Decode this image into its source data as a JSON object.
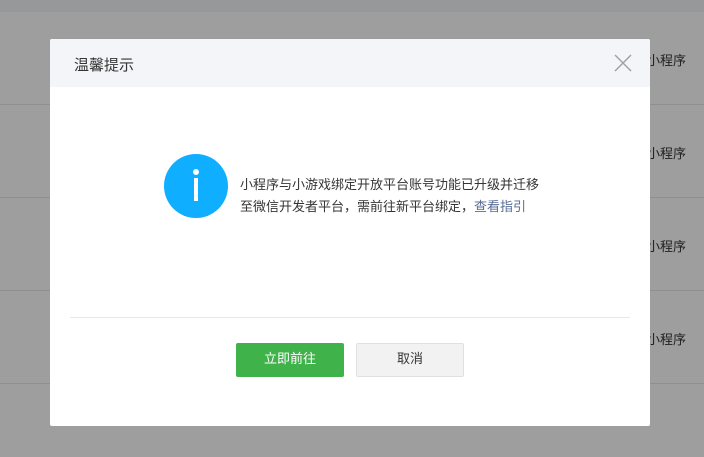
{
  "background": {
    "row_labels": [
      "小程序",
      "小程序",
      "小程序",
      "小程序"
    ]
  },
  "dialog": {
    "title": "温馨提示",
    "message_text": "小程序与小游戏绑定开放平台账号功能已升级并迁移至微信开发者平台，需前往新平台绑定，",
    "link_text": "查看指引",
    "primary_button": "立即前往",
    "cancel_button": "取消"
  },
  "colors": {
    "primary": "#3fb349",
    "info_icon": "#10aeff",
    "link": "#576b95"
  }
}
